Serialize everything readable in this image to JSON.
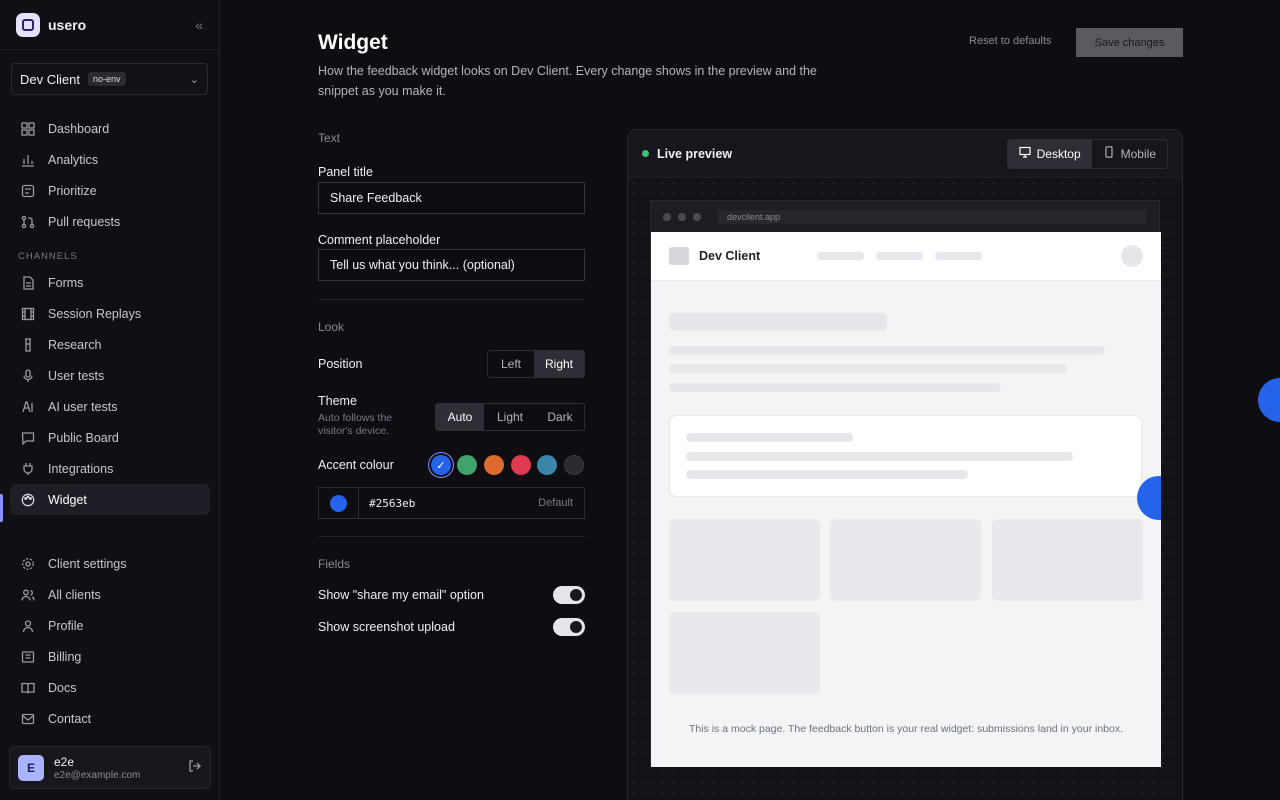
{
  "app": {
    "name": "usero"
  },
  "env": {
    "name": "Dev Client",
    "badge": "no-env"
  },
  "nav": {
    "top": [
      {
        "label": "Dashboard",
        "icon": "grid-icon"
      },
      {
        "label": "Analytics",
        "icon": "bar-chart-icon"
      },
      {
        "label": "Prioritize",
        "icon": "square-icon"
      },
      {
        "label": "Pull requests",
        "icon": "git-pull-icon"
      }
    ],
    "channels_label": "CHANNELS",
    "channels": [
      {
        "label": "Forms",
        "icon": "form-icon"
      },
      {
        "label": "Session Replays",
        "icon": "film-icon"
      },
      {
        "label": "Research",
        "icon": "flask-icon"
      },
      {
        "label": "User tests",
        "icon": "mic-icon"
      },
      {
        "label": "AI user tests",
        "icon": "bot-icon"
      },
      {
        "label": "Public Board",
        "icon": "message-icon"
      },
      {
        "label": "Integrations",
        "icon": "plug-icon"
      },
      {
        "label": "Widget",
        "icon": "palette-icon",
        "active": true
      }
    ],
    "bottom": [
      {
        "label": "Client settings",
        "icon": "gear-icon"
      },
      {
        "label": "All clients",
        "icon": "users-icon"
      },
      {
        "label": "Profile",
        "icon": "user-icon"
      },
      {
        "label": "Billing",
        "icon": "card-icon"
      },
      {
        "label": "Docs",
        "icon": "book-icon"
      },
      {
        "label": "Contact",
        "icon": "mail-icon"
      }
    ]
  },
  "user": {
    "initial": "E",
    "name": "e2e",
    "email": "e2e@example.com"
  },
  "header": {
    "title": "Widget",
    "description": "How the feedback widget looks on Dev Client. Every change shows in the preview and the snippet as you make it.",
    "reset_label": "Reset to defaults",
    "save_label": "Save changes"
  },
  "form": {
    "text_section": "Text",
    "panel_title_label": "Panel title",
    "panel_title_value": "Share Feedback",
    "comment_placeholder_label": "Comment placeholder",
    "comment_placeholder_value": "Tell us what you think... (optional)",
    "look_section": "Look",
    "position_label": "Position",
    "position_options": [
      "Left",
      "Right"
    ],
    "position_selected": "Right",
    "theme_label": "Theme",
    "theme_help": "Auto follows the visitor's device.",
    "theme_options": [
      "Auto",
      "Light",
      "Dark"
    ],
    "theme_selected": "Auto",
    "accent_label": "Accent colour",
    "accent_swatches": [
      "#2563eb",
      "#3fa36b",
      "#dd6a2e",
      "#e03a52",
      "#3a86a8",
      "#2b2b30"
    ],
    "accent_hex": "#2563eb",
    "accent_default": "Default",
    "fields_section": "Fields",
    "toggle_email_label": "Show \"share my email\" option",
    "toggle_screenshot_label": "Show screenshot upload"
  },
  "preview": {
    "live_label": "Live preview",
    "desktop_label": "Desktop",
    "mobile_label": "Mobile",
    "url": "devclient.app",
    "site_name": "Dev Client",
    "note": "This is a mock page. The feedback button is your real widget: submissions land in your inbox."
  }
}
